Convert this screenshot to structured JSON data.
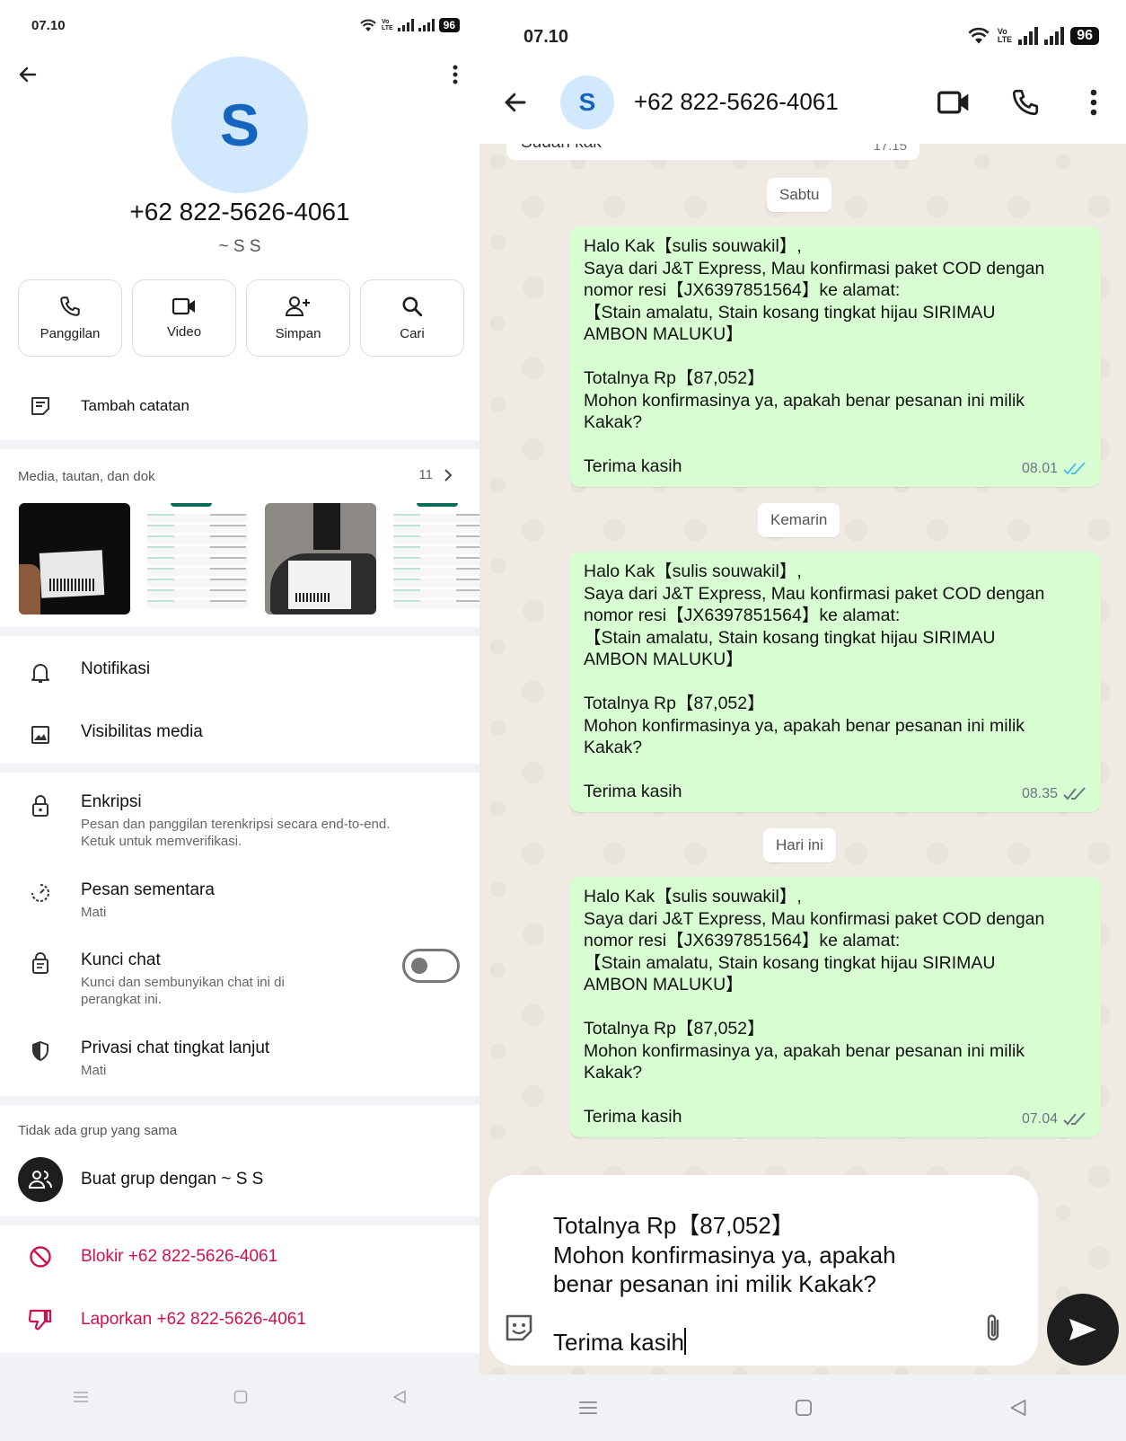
{
  "left": {
    "status": {
      "time": "07.10",
      "battery": "96"
    },
    "contact": {
      "avatar_letter": "S",
      "phone": "+62 822-5626-4061",
      "alias": "~ S S"
    },
    "actions": [
      {
        "label": "Panggilan",
        "icon": "phone-icon"
      },
      {
        "label": "Video",
        "icon": "video-icon"
      },
      {
        "label": "Simpan",
        "icon": "add-contact-icon"
      },
      {
        "label": "Cari",
        "icon": "search-icon"
      }
    ],
    "note": {
      "label": "Tambah catatan"
    },
    "media": {
      "heading": "Media, tautan, dan dok",
      "count": "11"
    },
    "settings": {
      "notifications": "Notifikasi",
      "media_visibility": "Visibilitas media",
      "encryption": {
        "title": "Enkripsi",
        "subtitle": "Pesan dan panggilan terenkripsi secara end-to-end.\nKetuk untuk memverifikasi."
      },
      "disappearing": {
        "title": "Pesan sementara",
        "subtitle": "Mati"
      },
      "chat_lock": {
        "title": "Kunci chat",
        "subtitle": "Kunci dan sembunyikan chat ini di\nperangkat ini.",
        "enabled": false
      },
      "advanced_privacy": {
        "title": "Privasi chat tingkat lanjut",
        "subtitle": "Mati"
      }
    },
    "groups": {
      "heading": "Tidak ada grup yang sama",
      "create_label": "Buat grup dengan ~ S S"
    },
    "danger": {
      "block": "Blokir +62 822-5626-4061",
      "report": "Laporkan +62 822-5626-4061"
    },
    "colors": {
      "accent_blue": "#1565c0",
      "danger": "#d0114f"
    }
  },
  "right": {
    "status": {
      "time": "07.10",
      "battery": "96"
    },
    "header": {
      "avatar_letter": "S",
      "name": "+62 822-5626-4061"
    },
    "previous": {
      "text": "Sudah kak",
      "time": "17.15"
    },
    "days": [
      "Sabtu",
      "Kemarin",
      "Hari ini"
    ],
    "messages": [
      {
        "text": "Halo Kak【sulis souwakil】,\nSaya dari J&T Express, Mau konfirmasi paket COD dengan\nnomor resi【JX6397851564】ke alamat:\n【Stain amalatu, Stain  kosang tingkat hijau SIRIMAU\nAMBON MALUKU】\n\nTotalnya Rp【87,052】\nMohon konfirmasinya ya, apakah benar pesanan ini milik\nKakak?\n\nTerima kasih",
        "time": "08.01",
        "status": "read"
      },
      {
        "text": "Halo Kak【sulis souwakil】,\nSaya dari J&T Express, Mau konfirmasi paket COD dengan\nnomor resi【JX6397851564】ke alamat:\n【Stain amalatu, Stain  kosang tingkat hijau SIRIMAU\nAMBON MALUKU】\n\nTotalnya Rp【87,052】\nMohon konfirmasinya ya, apakah benar pesanan ini milik\nKakak?\n\nTerima kasih",
        "time": "08.35",
        "status": "delivered"
      },
      {
        "text": "Halo Kak【sulis souwakil】,\nSaya dari J&T Express, Mau konfirmasi paket COD dengan\nnomor resi【JX6397851564】ke alamat:\n【Stain amalatu, Stain  kosang tingkat hijau SIRIMAU\nAMBON MALUKU】\n\nTotalnya Rp【87,052】\nMohon konfirmasinya ya, apakah benar pesanan ini milik\nKakak?\n\nTerima kasih",
        "time": "07.04",
        "status": "delivered"
      }
    ],
    "composer": {
      "draft": "Totalnya Rp【87,052】\nMohon konfirmasinya ya, apakah\nbenar pesanan ini milik Kakak?\n\nTerima kasih"
    },
    "colors": {
      "bubble": "#d9fdd3",
      "read_tick": "#53bdeb"
    }
  }
}
